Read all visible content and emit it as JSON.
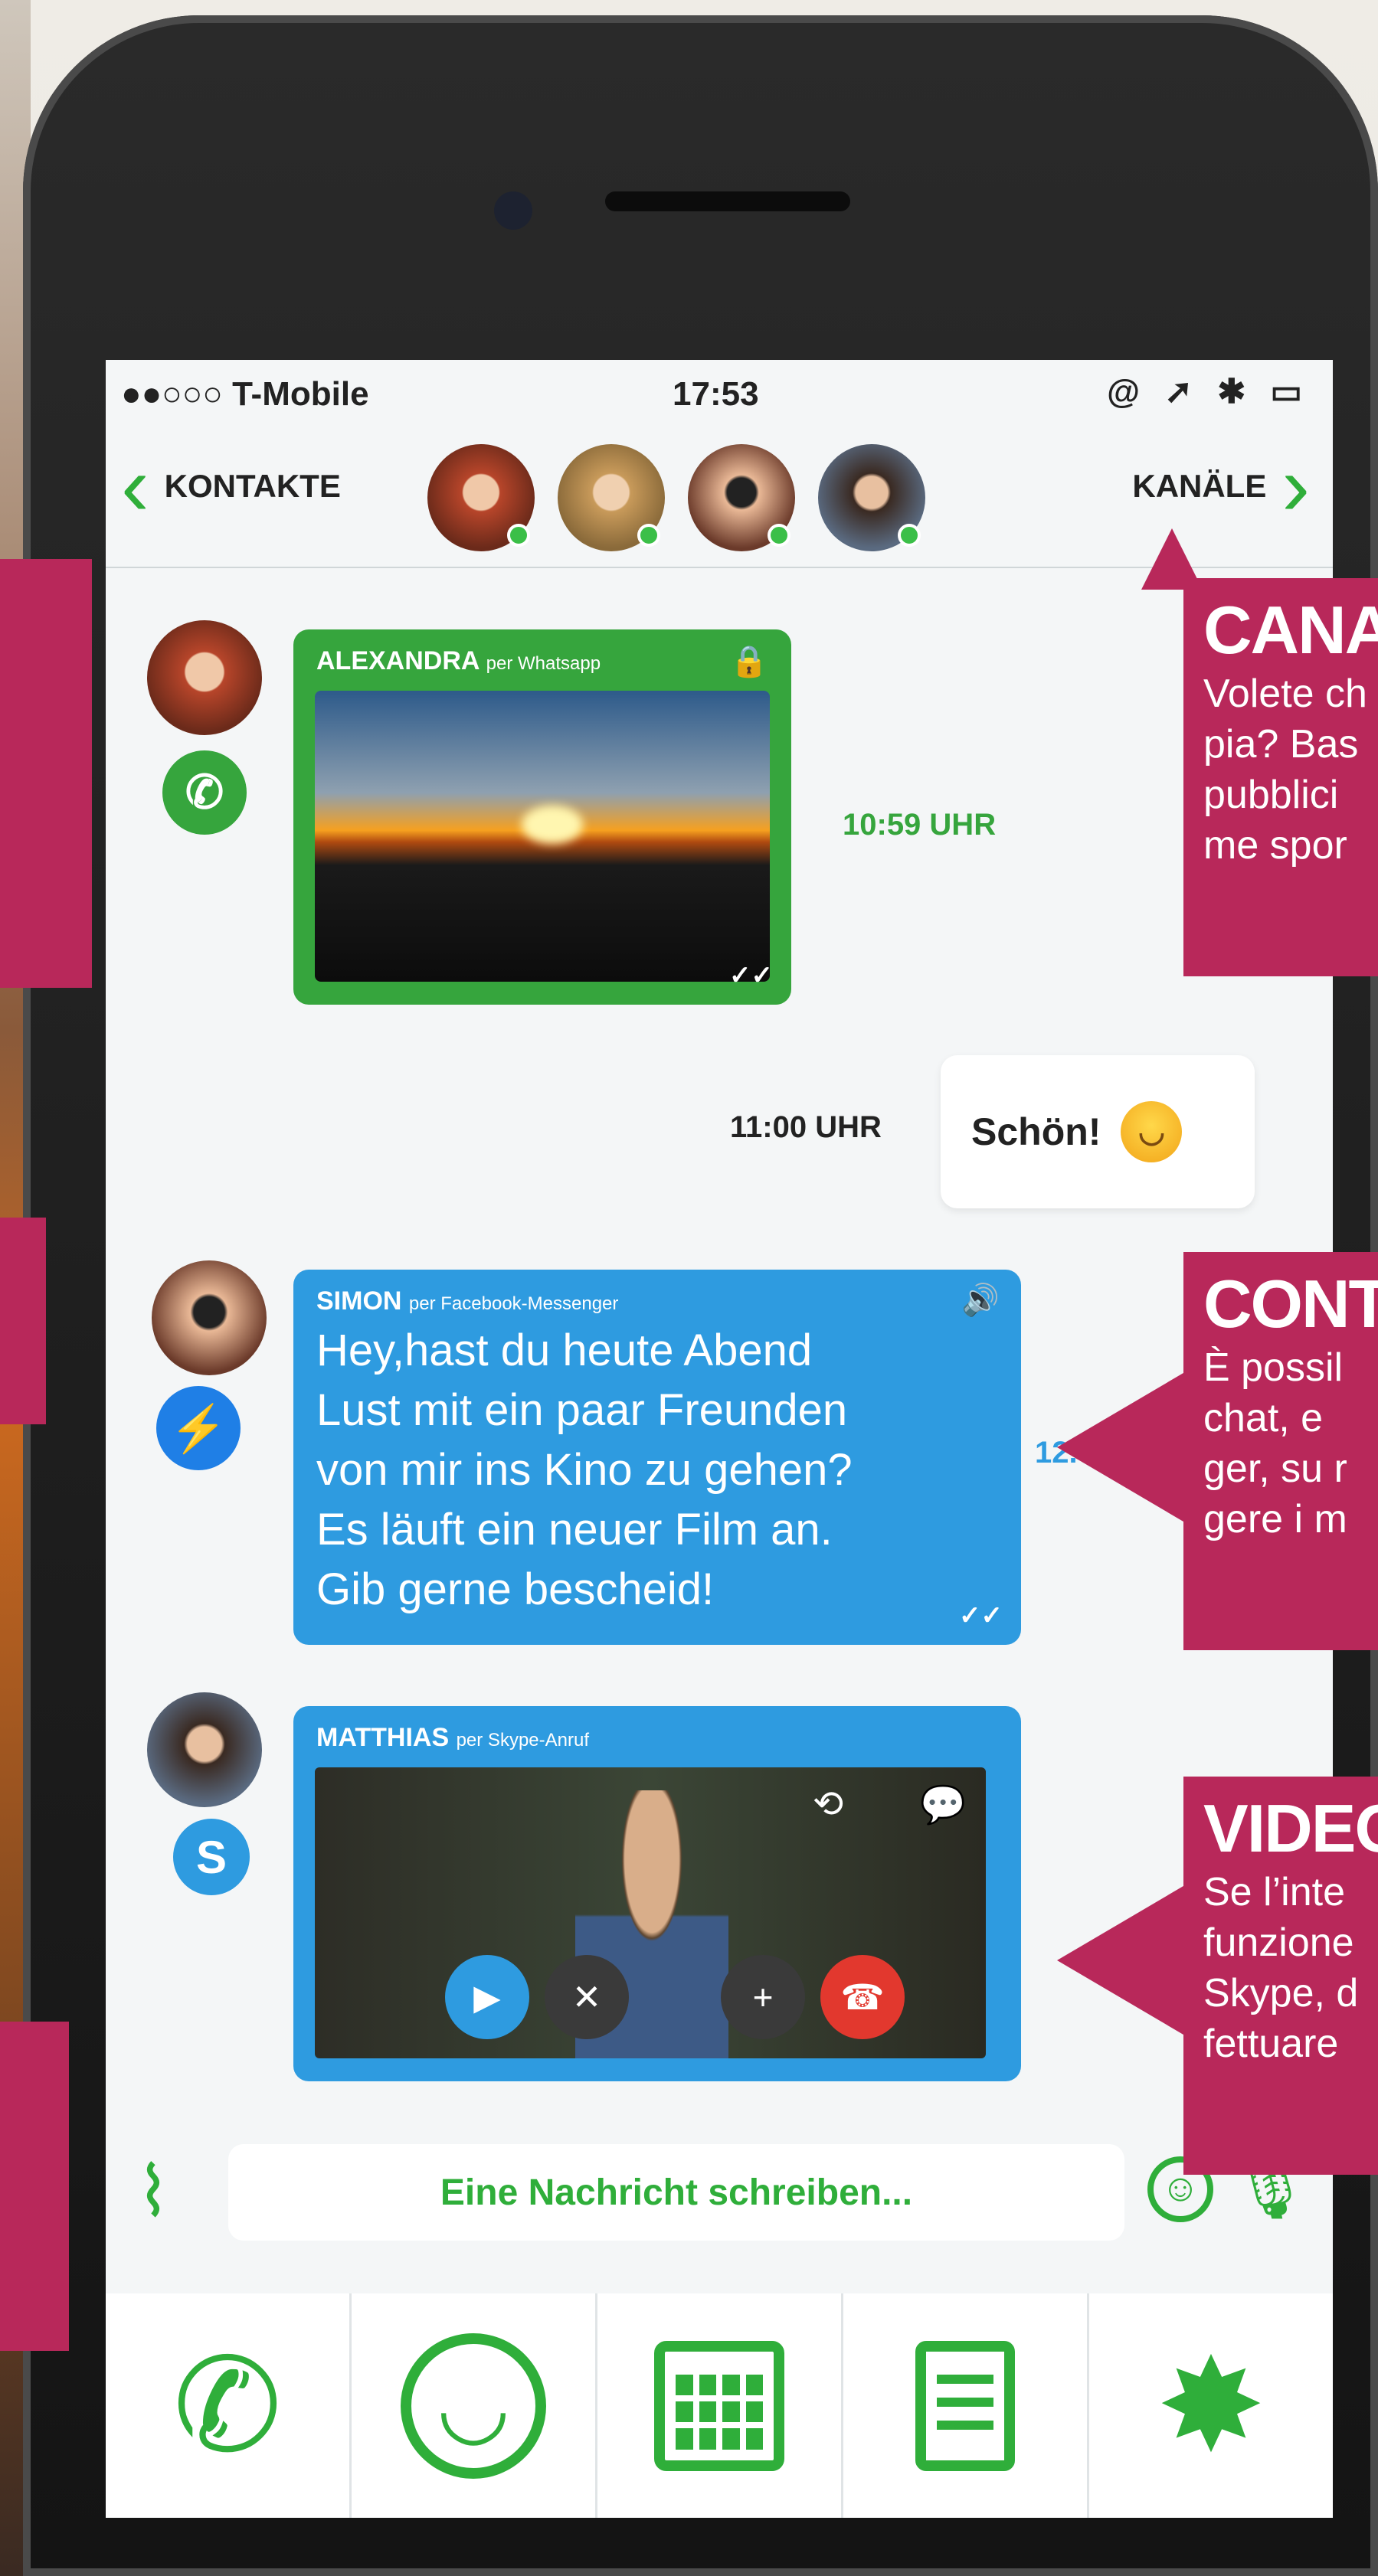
{
  "status_bar": {
    "carrier": "●●○○○ T-Mobile",
    "time": "17:53",
    "indicators": "@ ➚ ✱ ▭"
  },
  "nav": {
    "back_label": "KONTAKTE",
    "forward_label": "KANÄLE"
  },
  "contacts_online": [
    "Alexandra",
    "contact-2",
    "Simon",
    "Matthias"
  ],
  "messages": [
    {
      "sender": "ALEXANDRA",
      "channel": "per Whatsapp",
      "type": "image",
      "time": "10:59 UHR",
      "status": "✓✓",
      "icon": "whatsapp-icon"
    },
    {
      "type": "outgoing",
      "text": "Schön!",
      "time": "11:00 UHR",
      "emoji": "smiley"
    },
    {
      "sender": "SIMON",
      "channel": "per Facebook-Messenger",
      "type": "text",
      "lines": [
        "Hey,hast du heute Abend",
        "Lust mit ein paar Freunden",
        "von mir ins Kino zu gehen?",
        "Es läuft ein neuer Film an.",
        "Gib gerne bescheid!"
      ],
      "time": "12.",
      "status": "✓✓",
      "icon": "messenger-icon"
    },
    {
      "sender": "MATTHIAS",
      "channel": "per Skype-Anruf",
      "type": "video-call",
      "icon": "skype-icon"
    }
  ],
  "composer": {
    "placeholder": "Eine Nachricht schreiben..."
  },
  "callouts": [
    {
      "title": "CANAL",
      "lines": [
        "Volete ch",
        "pia? Bas",
        "pubblici",
        "me spor"
      ]
    },
    {
      "title": "CONTE",
      "lines": [
        "È possil",
        "chat, e",
        "ger, su r",
        "gere i m"
      ]
    },
    {
      "title": "VIDEO",
      "lines": [
        "Se l’inte",
        "funzione",
        "Skype, d",
        "fettuare"
      ]
    }
  ],
  "colors": {
    "accent": "#2fae3a",
    "whatsapp": "#36a53d",
    "messenger": "#2e9be0",
    "callout": "#b8285a"
  }
}
